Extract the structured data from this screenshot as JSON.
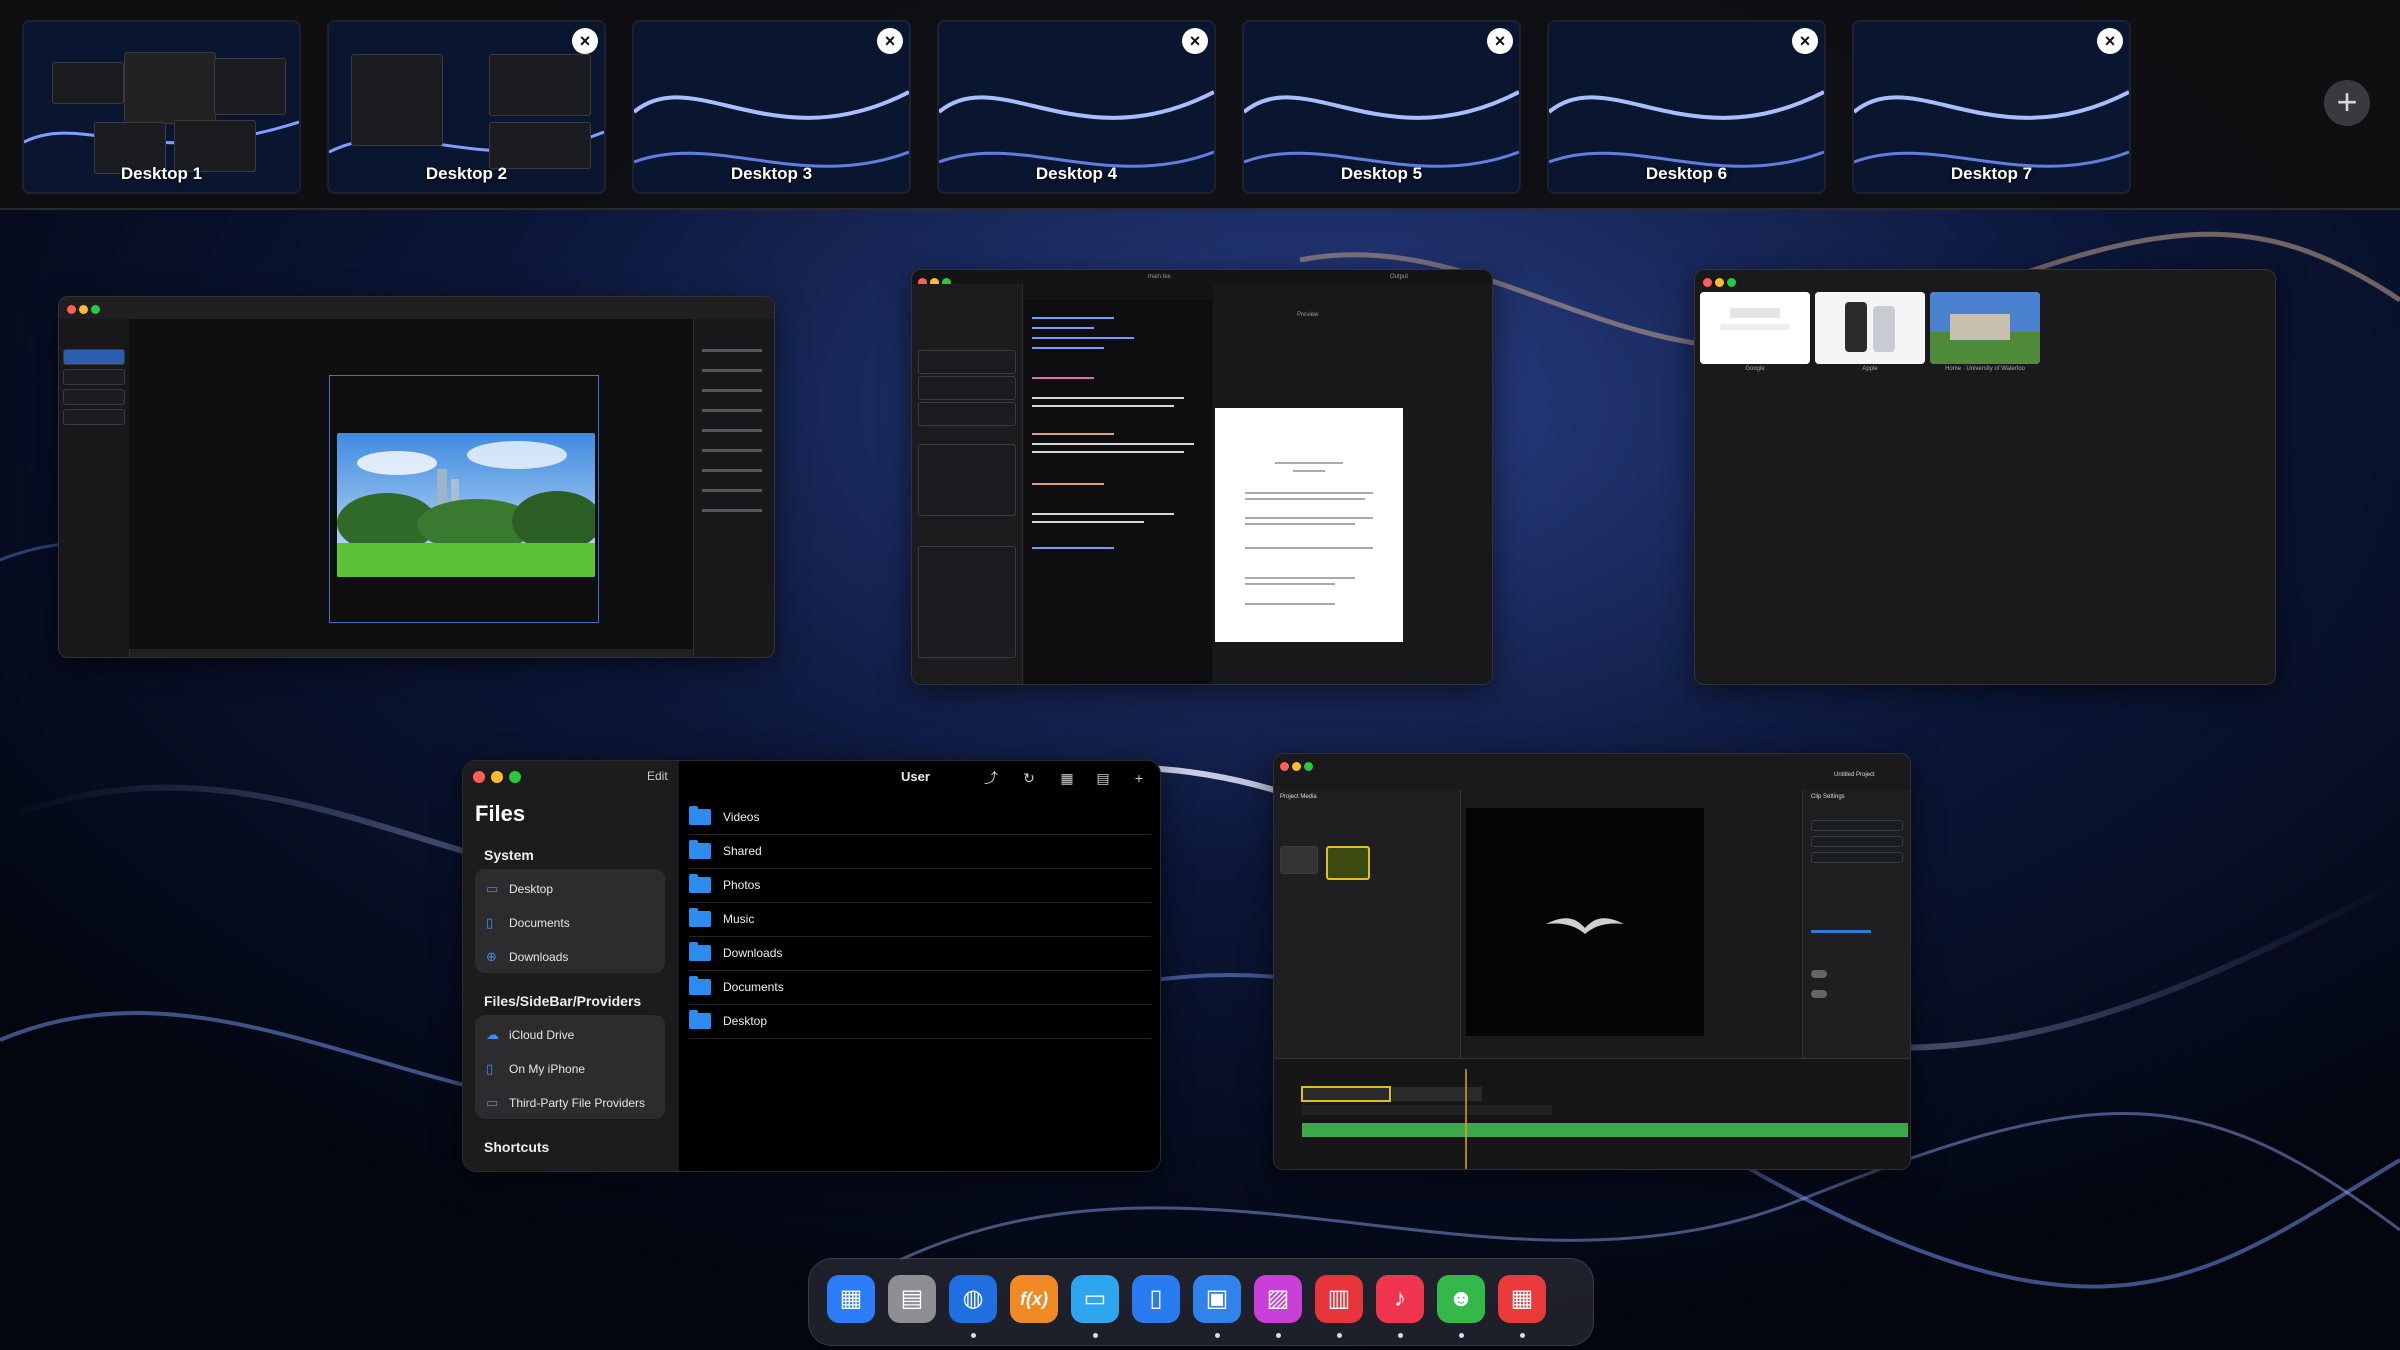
{
  "desktops": [
    {
      "label": "Desktop 1",
      "closable": false
    },
    {
      "label": "Desktop 2",
      "closable": true
    },
    {
      "label": "Desktop 3",
      "closable": true
    },
    {
      "label": "Desktop 4",
      "closable": true
    },
    {
      "label": "Desktop 5",
      "closable": true
    },
    {
      "label": "Desktop 6",
      "closable": true
    },
    {
      "label": "Desktop 7",
      "closable": true
    }
  ],
  "strip": {
    "close_glyph": "×",
    "add_glyph": "+"
  },
  "latex": {
    "tab_title": "main.tex",
    "output_label": "Output",
    "preview_label": "Preview"
  },
  "browser": {
    "tab_captions": [
      "Google",
      "Apple",
      "Home · University of Waterloo"
    ]
  },
  "files": {
    "title": "Files",
    "edit": "Edit",
    "path": "User",
    "system_header": "System",
    "system_items": [
      "Desktop",
      "Documents",
      "Downloads"
    ],
    "providers_header": "Files/SideBar/Providers",
    "provider_items": [
      "iCloud Drive",
      "On My iPhone",
      "Third-Party File Providers"
    ],
    "shortcuts_header": "Shortcuts",
    "folders": [
      "Videos",
      "Shared",
      "Photos",
      "Music",
      "Downloads",
      "Documents",
      "Desktop"
    ]
  },
  "video": {
    "project_title": "Untitled Project",
    "panel_title": "Clip Settings",
    "media_label": "Project Media"
  },
  "dock": {
    "apps": [
      {
        "name": "launchpad",
        "glyph": "▦",
        "color": "#2b7cf6",
        "running": false
      },
      {
        "name": "window-switcher",
        "glyph": "▤",
        "color": "#8e8e93",
        "running": false
      },
      {
        "name": "browser",
        "glyph": "◍",
        "color": "#1f6fe0",
        "running": true
      },
      {
        "name": "calculator",
        "glyph": "f(x)",
        "color": "#f08a24",
        "running": false
      },
      {
        "name": "files",
        "glyph": "▭",
        "color": "#2ea6ef",
        "running": true
      },
      {
        "name": "documents",
        "glyph": "▯",
        "color": "#2a7af0",
        "running": false
      },
      {
        "name": "text-editor",
        "glyph": "▣",
        "color": "#2f83ea",
        "running": true
      },
      {
        "name": "photos",
        "glyph": "▨",
        "color": "#c93fd8",
        "running": true
      },
      {
        "name": "video-editor",
        "glyph": "▥",
        "color": "#e8343b",
        "running": true
      },
      {
        "name": "music",
        "glyph": "♪",
        "color": "#f0364f",
        "running": true
      },
      {
        "name": "contacts",
        "glyph": "☻",
        "color": "#35b84a",
        "running": true
      },
      {
        "name": "calendar",
        "glyph": "▦",
        "color": "#ea3a3a",
        "running": true
      }
    ]
  }
}
